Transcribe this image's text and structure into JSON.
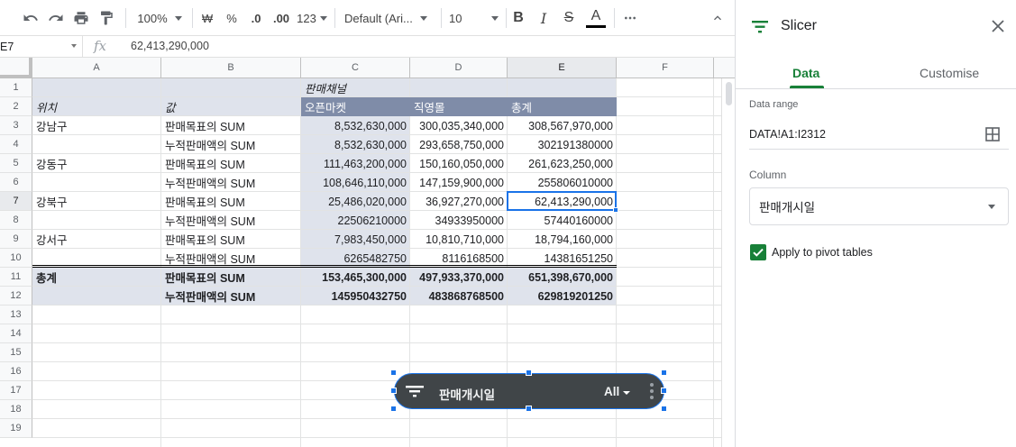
{
  "toolbar": {
    "zoom": "100%",
    "currency": "₩",
    "percent": "%",
    "decrease_decimal": ".0",
    "increase_decimal": ".00",
    "format_more": "123",
    "font": "Default (Ari...",
    "font_size": "10",
    "bold": "B",
    "italic": "I",
    "strike": "S",
    "text_color": "A"
  },
  "formula_bar": {
    "cell_ref": "E7",
    "fx": "fx",
    "value": "62,413,290,000"
  },
  "columns": [
    {
      "label": "A"
    },
    {
      "label": "B"
    },
    {
      "label": "C"
    },
    {
      "label": "D"
    },
    {
      "label": "E"
    },
    {
      "label": "F"
    }
  ],
  "rows": [
    "1",
    "2",
    "3",
    "4",
    "5",
    "6",
    "7",
    "8",
    "9",
    "10",
    "11",
    "12",
    "13",
    "14",
    "15",
    "16",
    "17",
    "18",
    "19"
  ],
  "pivot": {
    "group_header": "판매채널",
    "row1_labels": {
      "a": "위치",
      "b": "값"
    },
    "col_headers": [
      "오픈마켓",
      "직영몰",
      "총계"
    ],
    "data_rows": [
      {
        "a": "강남구",
        "b": "판매목표의 SUM",
        "c": "8,532,630,000",
        "d": "300,035,340,000",
        "e": "308,567,970,000"
      },
      {
        "a": "",
        "b": "누적판매액의 SUM",
        "c": "8,532,630,000",
        "d": "293,658,750,000",
        "e": "302191380000"
      },
      {
        "a": "강동구",
        "b": "판매목표의 SUM",
        "c": "111,463,200,000",
        "d": "150,160,050,000",
        "e": "261,623,250,000"
      },
      {
        "a": "",
        "b": "누적판매액의 SUM",
        "c": "108,646,110,000",
        "d": "147,159,900,000",
        "e": "255806010000"
      },
      {
        "a": "강북구",
        "b": "판매목표의 SUM",
        "c": "25,486,020,000",
        "d": "36,927,270,000",
        "e": "62,413,290,000"
      },
      {
        "a": "",
        "b": "누적판매액의 SUM",
        "c": "22506210000",
        "d": "34933950000",
        "e": "57440160000"
      },
      {
        "a": "강서구",
        "b": "판매목표의 SUM",
        "c": "7,983,450,000",
        "d": "10,810,710,000",
        "e": "18,794,160,000"
      },
      {
        "a": "",
        "b": "누적판매액의 SUM",
        "c": "6265482750",
        "d": "8116168500",
        "e": "14381651250"
      }
    ],
    "total_rows": [
      {
        "a": "총계",
        "b": "판매목표의 SUM",
        "c": "153,465,300,000",
        "d": "497,933,370,000",
        "e": "651,398,670,000"
      },
      {
        "a": "",
        "b": "누적판매액의 SUM",
        "c": "145950432750",
        "d": "483868768500",
        "e": "629819201250"
      }
    ]
  },
  "slicer_chip": {
    "column": "판매개시일",
    "value": "All"
  },
  "panel": {
    "title": "Slicer",
    "tabs": [
      "Data",
      "Customise"
    ],
    "data_range_label": "Data range",
    "data_range": "DATA!A1:I2312",
    "column_label": "Column",
    "column_value": "판매개시일",
    "apply_label": "Apply to pivot tables",
    "apply_checked": true
  },
  "colors": {
    "accent_green": "#188038",
    "pivot_header": "#7f8ca8",
    "pivot_light": "#dfe3ec",
    "selection": "#1a73e8"
  }
}
